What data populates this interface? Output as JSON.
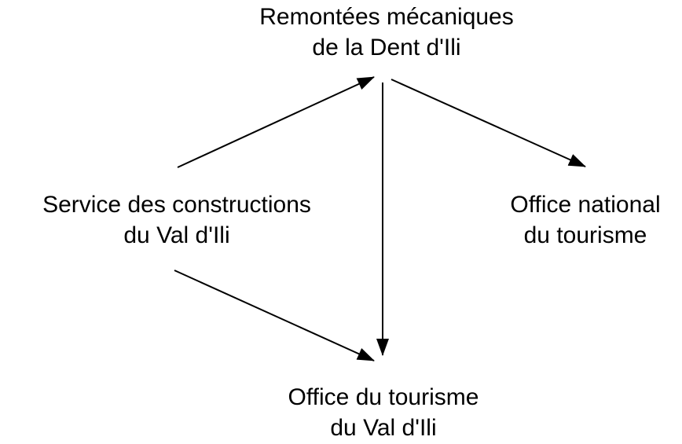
{
  "diagram": {
    "nodes": {
      "top": {
        "line1": "Remontées mécaniques",
        "line2": "de la Dent d'Ili"
      },
      "left": {
        "line1": "Service des constructions",
        "line2": "du Val d'Ili"
      },
      "right": {
        "line1": "Office national",
        "line2": "du tourisme"
      },
      "bottom": {
        "line1": "Office du tourisme",
        "line2": "du Val d'Ili"
      }
    },
    "edges": [
      {
        "from": "left",
        "to": "top"
      },
      {
        "from": "top",
        "to": "right"
      },
      {
        "from": "top",
        "to": "bottom"
      },
      {
        "from": "left",
        "to": "bottom"
      }
    ],
    "line_color": "#000000"
  }
}
